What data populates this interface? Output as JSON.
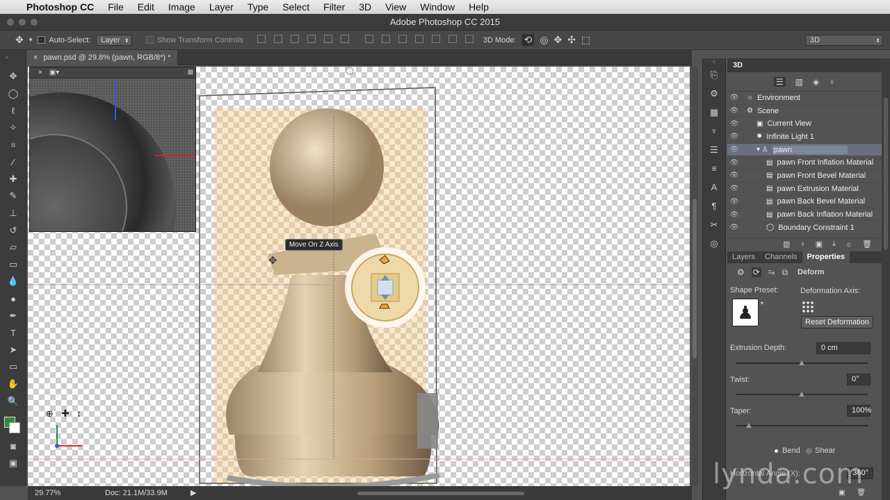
{
  "menubar": {
    "apple": "",
    "app": "Photoshop CC",
    "items": [
      "File",
      "Edit",
      "Image",
      "Layer",
      "Type",
      "Select",
      "Filter",
      "3D",
      "View",
      "Window",
      "Help"
    ]
  },
  "window": {
    "title": "Adobe Photoshop CC 2015"
  },
  "options": {
    "auto_select_label": "Auto-Select:",
    "auto_select_value": "Layer",
    "show_transform": "Show Transform Controls",
    "mode_label": "3D Mode:",
    "workspace": "3D"
  },
  "document": {
    "tab": "pawn.psd @ 29.8% (pawn, RGB/8*) *",
    "zoom": "29.77%",
    "doc_info": "Doc: 21.1M/33.9M"
  },
  "canvas": {
    "tooltip": "Move On Z Axis"
  },
  "panel3d": {
    "title": "3D",
    "items": [
      {
        "label": "Environment",
        "indent": 0
      },
      {
        "label": "Scene",
        "indent": 0
      },
      {
        "label": "Current View",
        "indent": 1
      },
      {
        "label": "Infinite Light 1",
        "indent": 1
      },
      {
        "label": "pawn",
        "indent": 1,
        "selected": true
      },
      {
        "label": "pawn Front Inflation Material",
        "indent": 2
      },
      {
        "label": "pawn Front Bevel Material",
        "indent": 2
      },
      {
        "label": "pawn Extrusion Material",
        "indent": 2
      },
      {
        "label": "pawn Back Bevel Material",
        "indent": 2
      },
      {
        "label": "pawn Back Inflation Material",
        "indent": 2
      },
      {
        "label": "Boundary Constraint 1",
        "indent": 2
      }
    ]
  },
  "props": {
    "tabs": [
      "Layers",
      "Channels",
      "Properties"
    ],
    "mode": "Deform",
    "shape_preset_label": "Shape Preset:",
    "def_axis_label": "Deformation Axis:",
    "reset_label": "Reset Deformation",
    "extrusion_label": "Extrusion Depth:",
    "extrusion_value": "0 cm",
    "extrusion_pos": 0.5,
    "twist_label": "Twist:",
    "twist_value": "0°",
    "twist_pos": 0.5,
    "taper_label": "Taper:",
    "taper_value": "100%",
    "taper_pos": 0.1,
    "bend_label": "Bend",
    "shear_label": "Shear",
    "angle_label": "Horizontal Angle (X):",
    "angle_value": "360°"
  },
  "watermark": "lynda.com",
  "colors": {
    "fg": "#2f8b3a",
    "bg": "#ffffff",
    "selection": "#6a6f80"
  }
}
